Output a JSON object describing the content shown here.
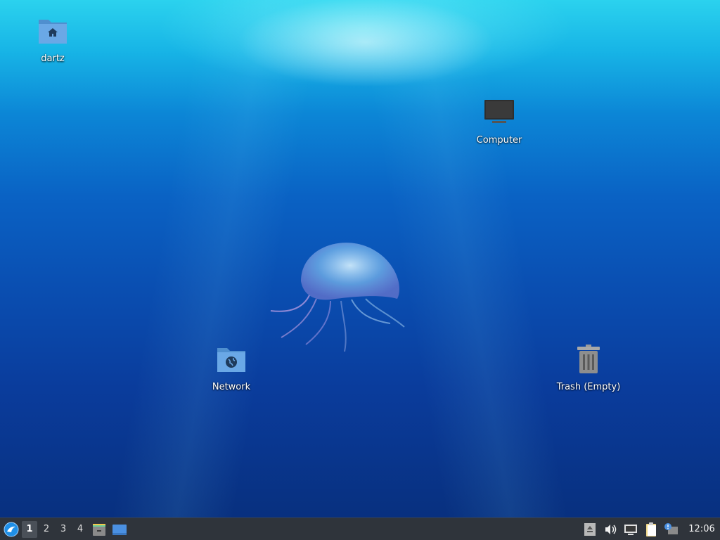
{
  "desktop": {
    "icons": [
      {
        "label": "dartz",
        "icon": "home-folder-icon"
      },
      {
        "label": "Computer",
        "icon": "computer-icon"
      },
      {
        "label": "Network",
        "icon": "network-folder-icon"
      },
      {
        "label": "Trash (Empty)",
        "icon": "trash-icon"
      }
    ]
  },
  "panel": {
    "start_icon": "lubuntu-logo-icon",
    "workspaces": [
      "1",
      "2",
      "3",
      "4"
    ],
    "active_workspace": "1",
    "launchers": [
      "file-manager-icon",
      "show-desktop-icon"
    ],
    "tray": [
      "eject-icon",
      "volume-icon",
      "network-icon",
      "clipboard-icon",
      "update-notifier-icon"
    ],
    "clock": "12:06"
  },
  "colors": {
    "panel_bg": "#2f343b",
    "folder_blue": "#5b9bd5",
    "text": "#ffffff"
  }
}
